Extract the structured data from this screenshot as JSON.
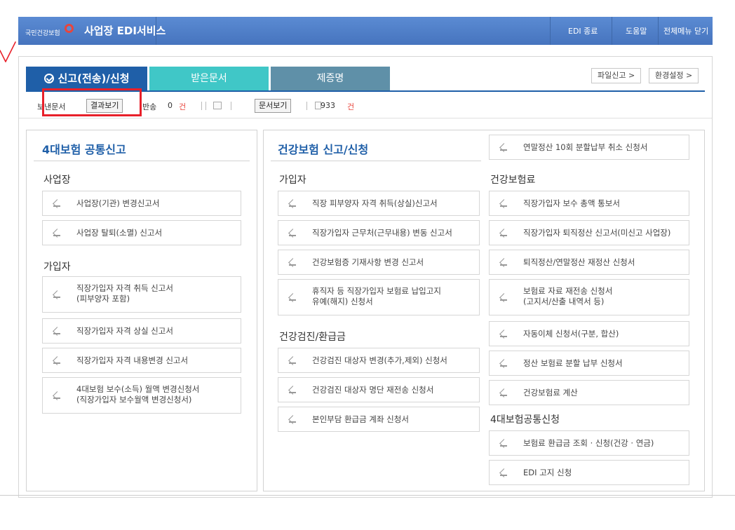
{
  "header": {
    "logo_text": "국민건강보험",
    "title": "사업장 EDI서비스",
    "links": [
      "EDI 종료",
      "도움말",
      "전체메뉴 닫기"
    ]
  },
  "tabs": [
    {
      "label": "신고(전송)/신청",
      "active": true
    },
    {
      "label": "받은문서",
      "active": false
    },
    {
      "label": "제증명",
      "active": false
    }
  ],
  "top_right_buttons": [
    "파일신고 >",
    "환경설정 >"
  ],
  "status": {
    "sent_label": "보낸문서",
    "result_button": "결과보기",
    "return_label": "반송",
    "return_count": "0",
    "count_unit": "건",
    "doc_view_button": "문서보기",
    "doc_count": "933",
    "doc_unit": "건"
  },
  "annotation": {
    "color": "#e8202a"
  },
  "left_section": {
    "title": "4대보험 공통신고",
    "groups": [
      {
        "title": "사업장",
        "items": [
          "사업장(기관) 변경신고서",
          "사업장 탈퇴(소멸) 신고서"
        ]
      },
      {
        "title": "가입자",
        "items": [
          "직장가입자 자격 취득 신고서\n(피부양자 포함)",
          "직장가입자 자격 상실 신고서",
          "직장가입자 자격 내용변경 신고서",
          "4대보험 보수(소득) 월액 변경신청서\n(직장가입자 보수월액 변경신청서)"
        ]
      }
    ]
  },
  "right_section": {
    "title": "건강보험 신고/신청",
    "top_item": "연말정산 10회 분할납부 취소 신청서",
    "col1_groups": [
      {
        "title": "가입자",
        "items": [
          "직장 피부양자 자격 취득(상실)신고서",
          "직장가입자 근무처(근무내용) 변동 신고서",
          "건강보험증 기재사항 변경 신고서",
          "휴직자 등 직장가입자 보험료 납입고지\n유예(해지) 신청서"
        ]
      },
      {
        "title": "건강검진/환급금",
        "items": [
          "건강검진 대상자 변경(추가,제외) 신청서",
          "건강검진 대상자 명단 재전송 신청서",
          "본인부담 환급금 계좌 신청서"
        ]
      }
    ],
    "col2_groups": [
      {
        "title": "건강보험료",
        "items": [
          "직장가입자 보수 총액 통보서",
          "직장가입자 퇴직정산 신고서(미신고 사업장)",
          "퇴직정산/연말정산 재정산 신청서",
          "보험료 자료 재전송 신청서\n(고지서/산출 내역서 등)",
          "자동이체 신청서(구분, 합산)",
          "정산 보험료 분할 납부 신청서",
          "건강보험료 계산"
        ]
      },
      {
        "title": "4대보험공통신청",
        "items": [
          "보험료 환급금 조회 · 신청(건강 · 연금)",
          "EDI 고지 신청"
        ]
      }
    ]
  }
}
